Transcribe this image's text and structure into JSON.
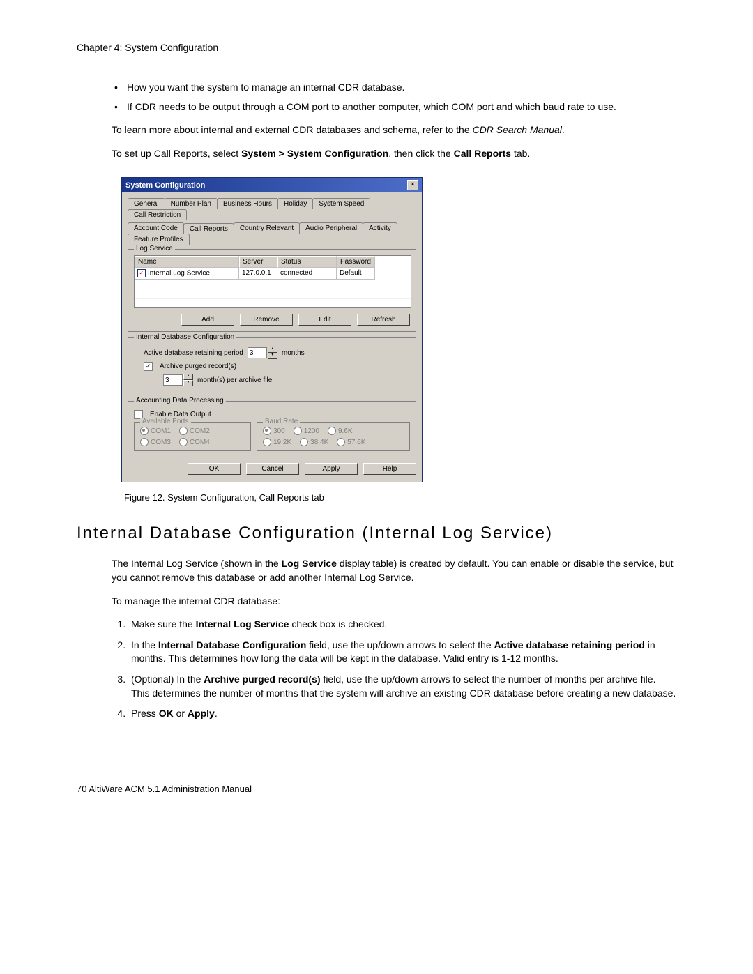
{
  "header": {
    "chapter": "Chapter 4:  System Configuration"
  },
  "bullets": [
    "How you want the system to manage an internal CDR database.",
    "If CDR needs to be output through a COM port to another computer, which COM port and which baud rate to use."
  ],
  "para1a": "To learn more about internal and external CDR databases and schema, refer to the ",
  "para1b": "CDR Search Manual",
  "para1c": ".",
  "para2a": "To set up Call Reports, select ",
  "para2b": "System > System Configuration",
  "para2c": ", then click the ",
  "para2d": "Call Reports",
  "para2e": " tab.",
  "dialog": {
    "title": "System Configuration",
    "close": "×",
    "tabs_row1": [
      "General",
      "Number Plan",
      "Business Hours",
      "Holiday",
      "System Speed",
      "Call Restriction"
    ],
    "tabs_row2": [
      "Account Code",
      "Call Reports",
      "Country Relevant",
      "Audio Peripheral",
      "Activity",
      "Feature Profiles"
    ],
    "log_service": {
      "legend": "Log Service",
      "columns": [
        "Name",
        "Server",
        "Status",
        "Password"
      ],
      "row": {
        "checked": "✓",
        "name": "Internal Log Service",
        "server": "127.0.0.1",
        "status": "connected",
        "password": "Default"
      },
      "buttons": [
        "Add",
        "Remove",
        "Edit",
        "Refresh"
      ]
    },
    "idb": {
      "legend": "Internal Database Configuration",
      "retain_label": "Active database retaining period",
      "retain_value": "3",
      "months": "months",
      "archive_check": "Archive purged record(s)",
      "archive_value": "3",
      "archive_suffix": "month(s) per archive file"
    },
    "adp": {
      "legend": "Accounting Data Processing",
      "enable": "Enable Data Output",
      "ports_legend": "Available Ports",
      "ports": [
        "COM1",
        "COM2",
        "COM3",
        "COM4"
      ],
      "baud_legend": "Baud Rate",
      "bauds": [
        "300",
        "1200",
        "9.6K",
        "19.2K",
        "38.4K",
        "57.6K"
      ]
    },
    "bottom_buttons": [
      "OK",
      "Cancel",
      "Apply",
      "Help"
    ]
  },
  "figure_caption": "Figure 12.   System Configuration, Call Reports tab",
  "section_heading": "Internal Database Configuration (Internal Log Service)",
  "section_para1a": "The Internal Log Service (shown in the ",
  "section_para1b": "Log Service",
  "section_para1c": " display table) is created by default. You can enable or disable the service, but you cannot remove this database or add another Internal Log Service.",
  "section_para2": "To manage the internal CDR database:",
  "numitems": {
    "n1a": "Make sure the ",
    "n1b": "Internal Log Service",
    "n1c": " check box is checked.",
    "n2a": "In the ",
    "n2b": "Internal Database Configuration",
    "n2c": " field, use the up/down arrows to select the ",
    "n2d": "Active database retaining period",
    "n2e": " in months. This determines how long the data will be kept in the database. Valid entry is 1-12 months.",
    "n3a": "(Optional) In the ",
    "n3b": "Archive purged record(s)",
    "n3c": " field, use the up/down arrows to select the number of months per archive file. This determines the number of months that the system will archive an existing CDR database before creating a new database.",
    "n4a": "Press ",
    "n4b": "OK",
    "n4c": " or ",
    "n4d": "Apply",
    "n4e": "."
  },
  "footer": "70   AltiWare ACM 5.1 Administration Manual"
}
